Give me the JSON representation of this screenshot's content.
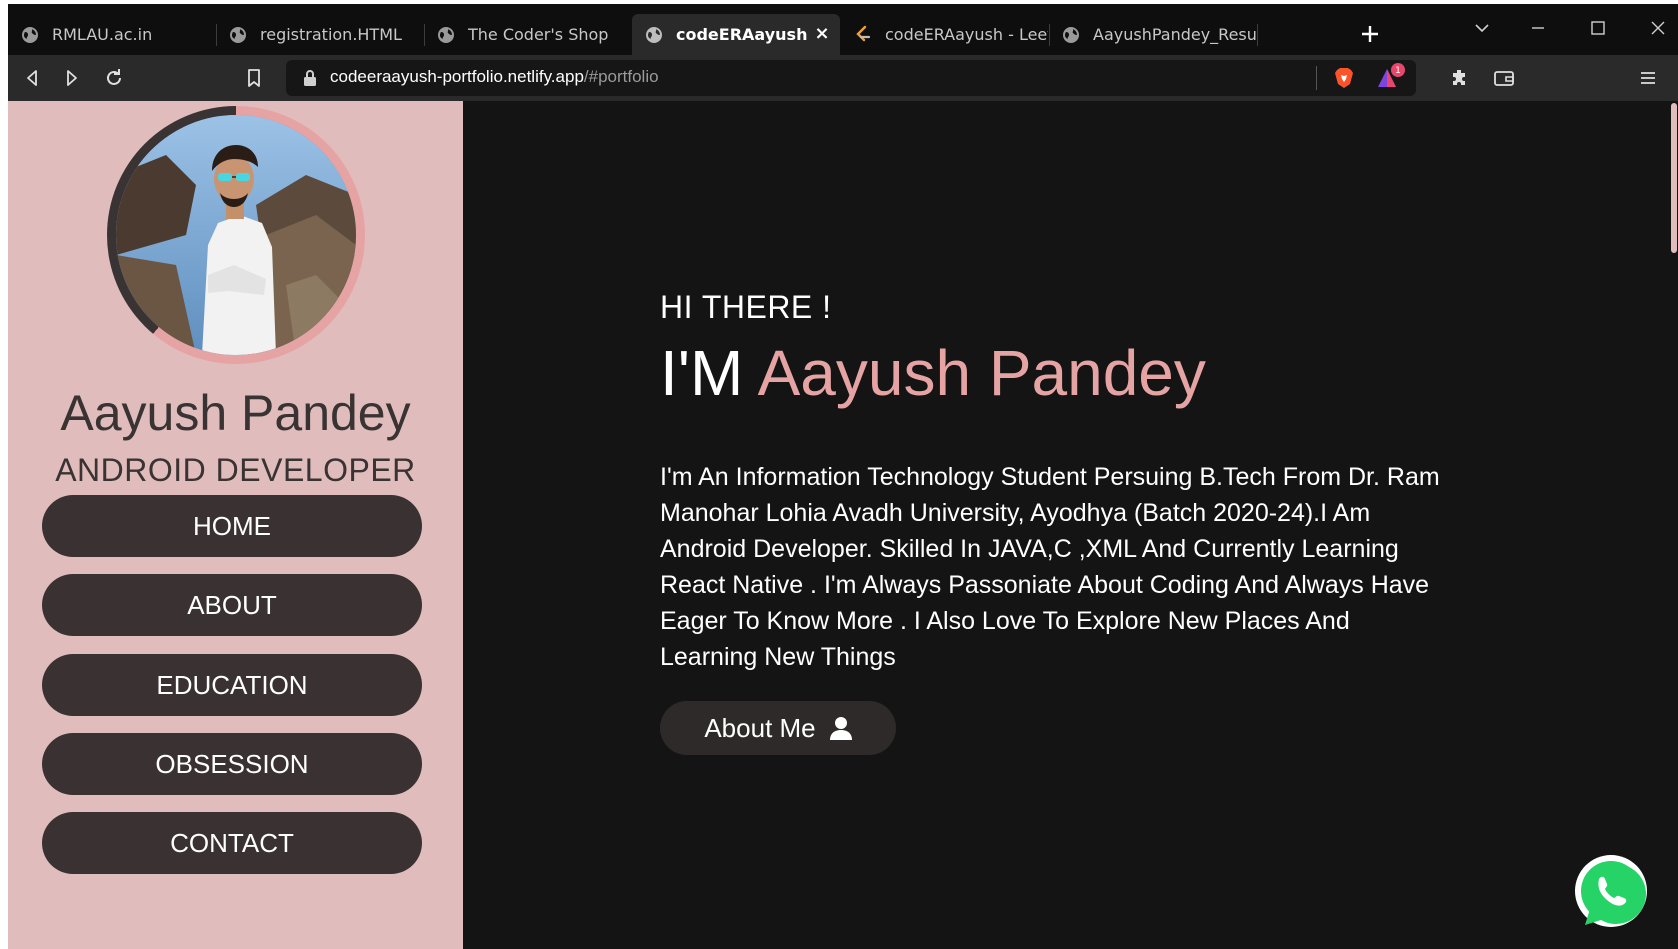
{
  "browser": {
    "tabs": [
      {
        "title": "RMLAU.ac.in",
        "icon": "globe-icon",
        "active": false
      },
      {
        "title": "registration.HTML",
        "icon": "globe-icon",
        "active": false
      },
      {
        "title": "The Coder's Shop",
        "icon": "globe-icon",
        "active": false
      },
      {
        "title": "codeERAayush",
        "icon": "globe-icon",
        "active": true
      },
      {
        "title": "codeERAayush - LeetCod",
        "icon": "leetcode-icon",
        "active": false
      },
      {
        "title": "AayushPandey_Resume.p",
        "icon": "globe-icon",
        "active": false
      }
    ],
    "close_glyph": "×",
    "address": {
      "host": "codeeraayush-portfolio.netlify.app",
      "path": "/#portfolio"
    },
    "rewards_badge": "1"
  },
  "sidebar": {
    "name": "Aayush Pandey",
    "role": "ANDROID DEVELOPER",
    "nav": [
      {
        "label": "HOME"
      },
      {
        "label": "ABOUT"
      },
      {
        "label": "EDUCATION"
      },
      {
        "label": "OBSESSION"
      },
      {
        "label": "CONTACT"
      }
    ]
  },
  "hero": {
    "greeting": "HI THERE !",
    "headline_prefix": "I'M",
    "headline_name": "Aayush Pandey",
    "bio": "I'm An Information Technology Student Persuing B.Tech From Dr. Ram Manohar Lohia Avadh University, Ayodhya (Batch 2020-24).I Am Android Developer. Skilled In JAVA,C ,XML And Currently Learning React Native . I'm Always Passoniate About Coding And Always Have Eager To Know More . I Also Love To Explore New Places And Learning New Things",
    "about_button": "About Me"
  },
  "colors": {
    "accent": "#e5a3a3",
    "sidebar_bg": "#e0bcbc",
    "button_dark": "#3a3232",
    "page_bg": "#141414",
    "whatsapp_green": "#25d366"
  }
}
